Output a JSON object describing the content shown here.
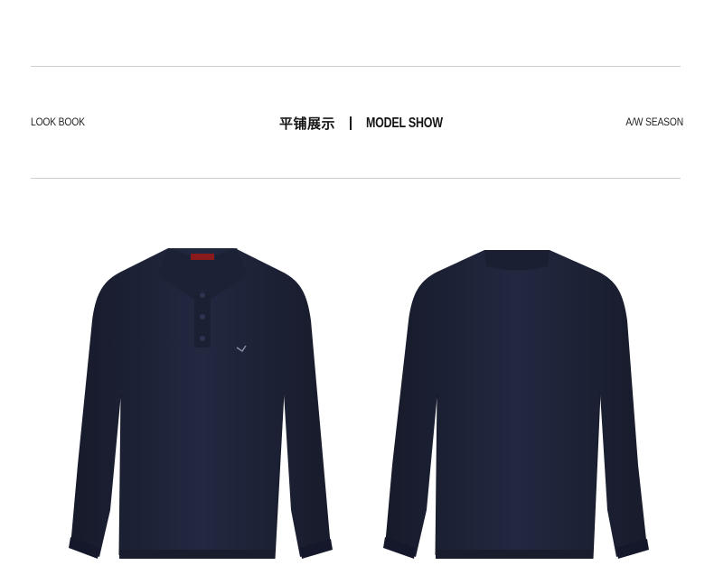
{
  "header": {
    "left_label": "LOOK BOOK",
    "center_cn": "平铺展示",
    "center_en": "MODEL SHOW",
    "right_label": "A/W SEASON"
  },
  "products": [
    {
      "view": "front",
      "color": "#1e2336"
    },
    {
      "view": "back",
      "color": "#1e2336"
    }
  ],
  "colors": {
    "rule": "#cfcfcf",
    "text": "#1a1a1a",
    "garment": "#1e2336",
    "collar_label": "#8b1a1a"
  }
}
